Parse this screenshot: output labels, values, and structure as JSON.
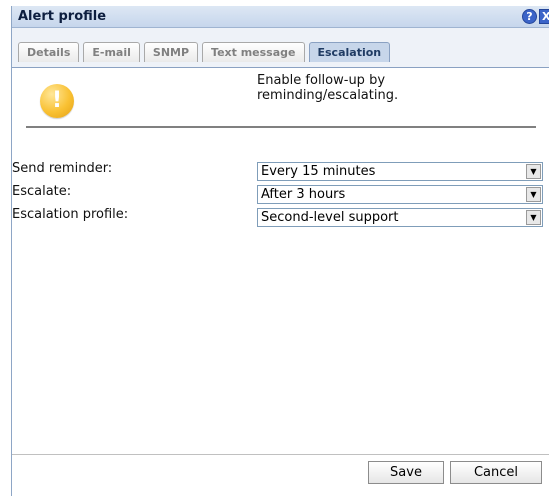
{
  "window": {
    "title": "Alert profile",
    "help_glyph": "?",
    "close_glyph": "X"
  },
  "tabs": [
    {
      "label": "Details",
      "active": false
    },
    {
      "label": "E-mail",
      "active": false
    },
    {
      "label": "SNMP",
      "active": false
    },
    {
      "label": "Text message",
      "active": false
    },
    {
      "label": "Escalation",
      "active": true
    }
  ],
  "info": {
    "icon": "warning-icon",
    "icon_glyph": "!",
    "text_line1": "Enable follow-up by",
    "text_line2": "reminding/escalating."
  },
  "form": {
    "send_reminder": {
      "label": "Send reminder:",
      "value": "Every 15 minutes"
    },
    "escalate": {
      "label": "Escalate:",
      "value": "After 3 hours"
    },
    "escalation_profile": {
      "label": "Escalation profile:",
      "value": "Second-level support"
    }
  },
  "buttons": {
    "save": "Save",
    "cancel": "Cancel"
  },
  "colors": {
    "titlebar": "#c6d6ec",
    "active_tab": "#c7d6ea",
    "warning": "#f9c133"
  }
}
